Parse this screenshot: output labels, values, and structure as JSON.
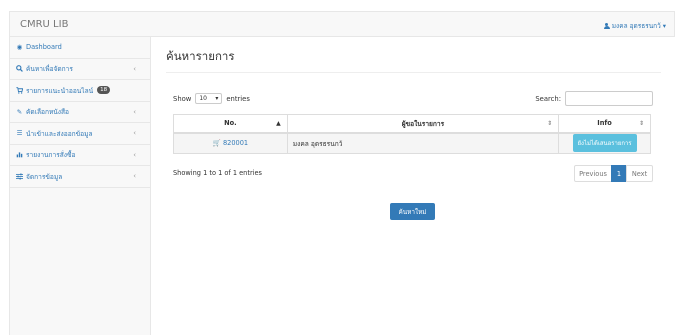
{
  "app": {
    "brand": "CMRU LIB"
  },
  "user": {
    "name": "มงคล อุดรธรนกว้",
    "caret": "▾"
  },
  "sidebar": {
    "items": [
      {
        "label": "Dashboard",
        "icon": "dashboard-icon",
        "glyph": "◉",
        "arrow": ""
      },
      {
        "label": "ค้นหาเพื่อจัดการ",
        "icon": "search-icon",
        "glyph": "🔍",
        "arrow": "‹"
      },
      {
        "label": "รายการแนะนำออนไลน์",
        "icon": "cart-icon",
        "glyph": "🛒",
        "arrow": "",
        "badge": "18"
      },
      {
        "label": "คัดเลือกหนังสือ",
        "icon": "edit-icon",
        "glyph": "✎",
        "arrow": "‹"
      },
      {
        "label": "นำเข้าและส่งออกข้อมูล",
        "icon": "list-icon",
        "glyph": "☰",
        "arrow": "‹"
      },
      {
        "label": "รายงานการสั่งซื้อ",
        "icon": "chart-icon",
        "glyph": "▥",
        "arrow": "‹"
      },
      {
        "label": "จัดการข้อมูล",
        "icon": "sliders-icon",
        "glyph": "☷",
        "arrow": "‹"
      }
    ]
  },
  "main": {
    "title": "ค้นหารายการ",
    "show_label": "Show",
    "page_size": "10",
    "entries_label": "entries",
    "search_label": "Search:",
    "search_value": "",
    "columns": {
      "no": "No.",
      "name": "ผู้ขอในรายการ",
      "info": "Info"
    },
    "rows": [
      {
        "no": "820001",
        "name": "มงคล อุดรธรนกว้",
        "info_button": "ยังไม่ได้เสนอรายการ"
      }
    ],
    "footer_info": "Showing 1 to 1 of 1 entries",
    "pager": {
      "prev": "Previous",
      "current": "1",
      "next": "Next"
    },
    "new_search_button": "ค้นหาใหม่"
  }
}
